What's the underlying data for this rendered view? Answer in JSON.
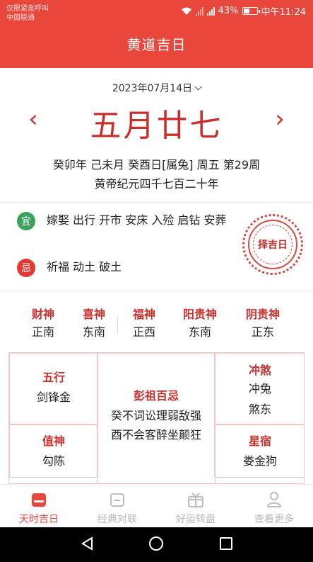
{
  "status_bar": {
    "carrier_line1": "仅限紧急呼叫",
    "carrier_line2": "中国联通",
    "battery": "43%",
    "battery_level": 0.43,
    "time": "中午11:24"
  },
  "header": {
    "title": "黄道吉日"
  },
  "date_picker": {
    "value": "2023年07月14日"
  },
  "lunar": {
    "date": "五月廿七",
    "prev_label": "‹",
    "next_label": "›",
    "ganzhi": "癸卯年 己未月 癸酉日[属兔] 周五 第29周",
    "huangdi": "黄帝纪元四千七百二十年"
  },
  "yi": {
    "badge": "宜",
    "text": "嫁娶 出行 开市 安床 入殓 启钻 安葬"
  },
  "ji": {
    "badge": "忌",
    "text": "祈福 动土 破土"
  },
  "seal_text": "择吉日",
  "gods": [
    {
      "title": "财神",
      "value": "正南"
    },
    {
      "title": "喜神",
      "value": "东南"
    },
    {
      "title": "福神",
      "value": "正西"
    },
    {
      "title": "阳贵神",
      "value": "东南"
    },
    {
      "title": "阴贵神",
      "value": "正东"
    }
  ],
  "grid": {
    "wuxing": {
      "title": "五行",
      "value": "剑锋金"
    },
    "pengzu": {
      "title": "彭祖百忌",
      "line1": "癸不词讼理弱敌强",
      "line2": "酉不会客醉坐颠狂"
    },
    "chongsha": {
      "title": "冲煞",
      "line1": "冲兔",
      "line2": "煞东"
    },
    "zhishen": {
      "title": "值神",
      "value": "勾陈"
    },
    "xingxiu": {
      "title": "星宿",
      "value": "娄金狗"
    }
  },
  "tabs": [
    {
      "label": "天时吉日",
      "icon": "calendar-icon",
      "active": true
    },
    {
      "label": "经典对联",
      "icon": "scroll-icon",
      "active": false
    },
    {
      "label": "好运转盘",
      "icon": "gift-icon",
      "active": false
    },
    {
      "label": "查看更多",
      "icon": "user-icon",
      "active": false
    }
  ],
  "colors": {
    "primary": "#e9473c",
    "accent_text": "#c9302c",
    "yi_green": "#3aa35b",
    "ji_red": "#e23a33"
  }
}
